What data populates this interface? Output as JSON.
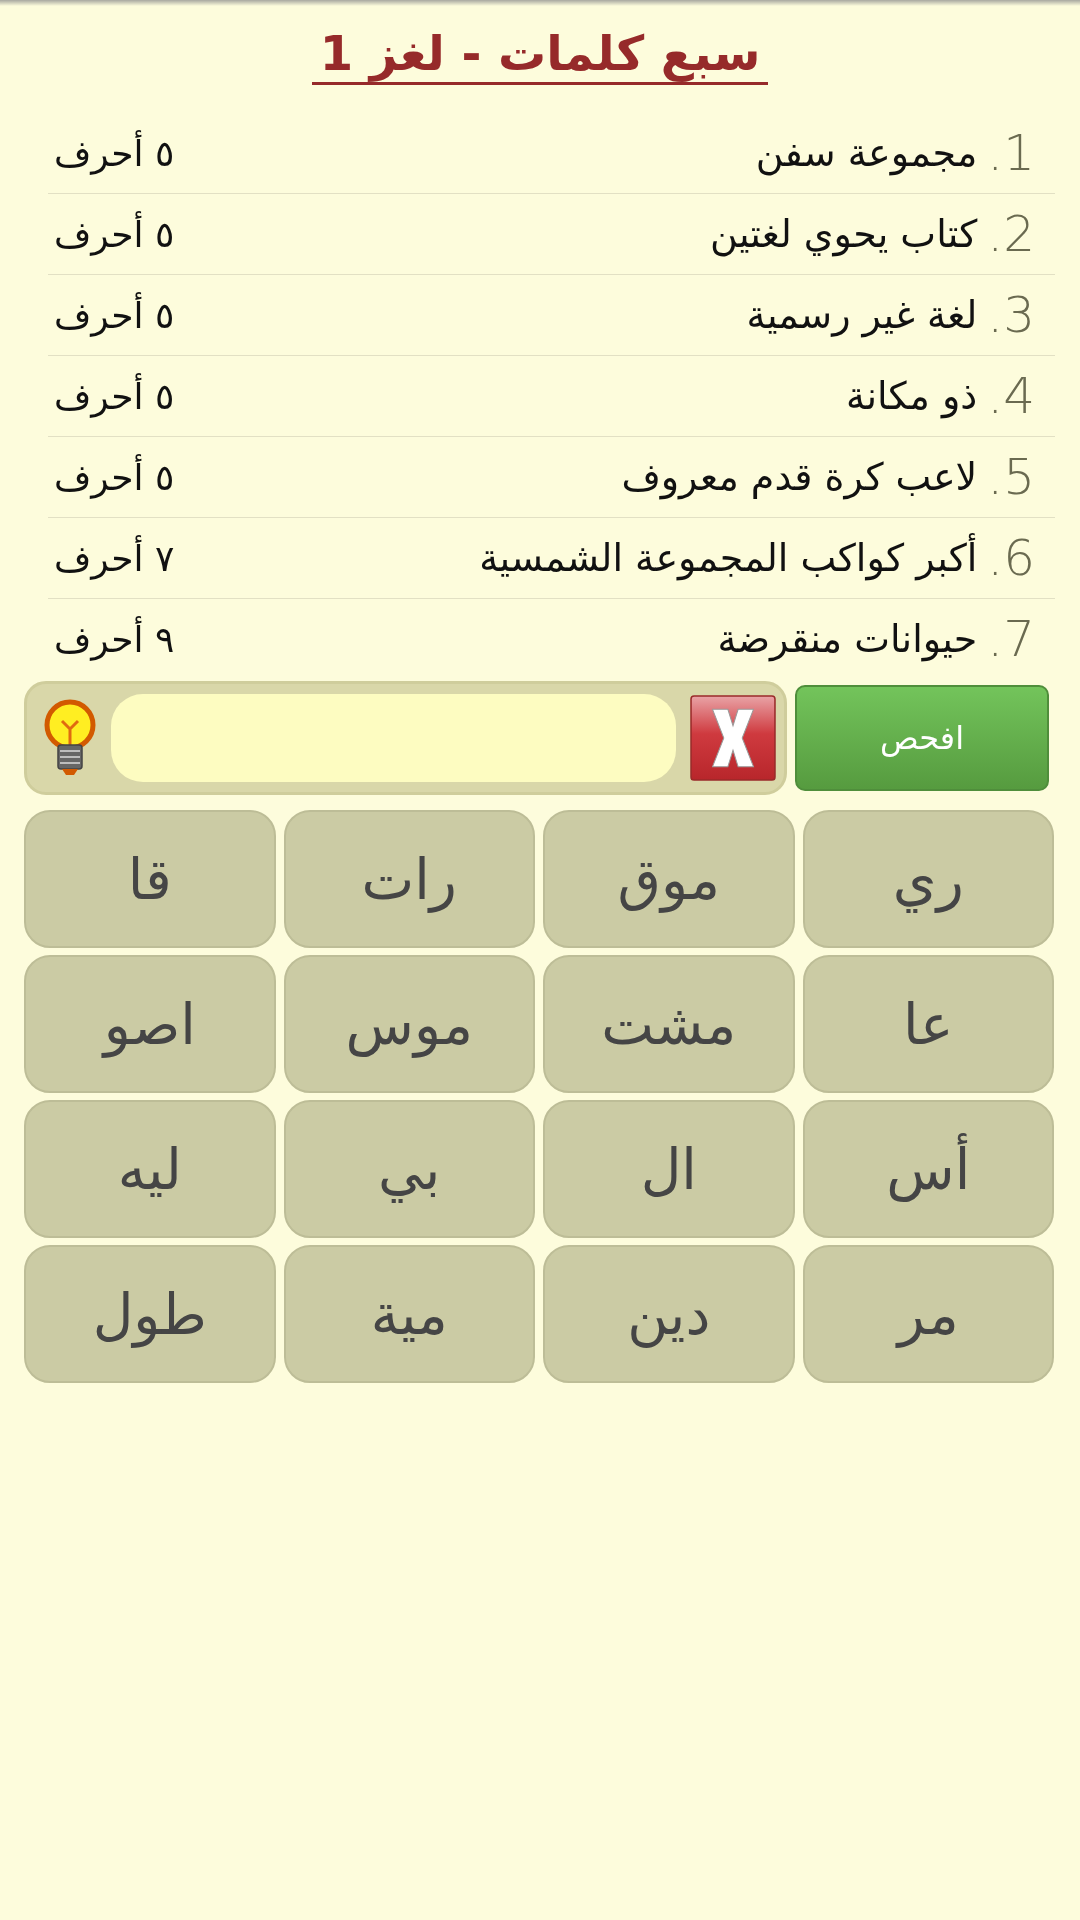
{
  "title": "سبع كلمات - لغز 1",
  "clues": [
    {
      "number": "1.",
      "text": "مجموعة سفن",
      "length": "٥ أحرف"
    },
    {
      "number": "2.",
      "text": "كتاب يحوي لغتين",
      "length": "٥ أحرف"
    },
    {
      "number": "3.",
      "text": "لغة غير رسمية",
      "length": "٥ أحرف"
    },
    {
      "number": "4.",
      "text": "ذو مكانة",
      "length": "٥ أحرف"
    },
    {
      "number": "5.",
      "text": "لاعب كرة قدم معروف",
      "length": "٥ أحرف"
    },
    {
      "number": "6.",
      "text": "أكبر كواكب المجموعة الشمسية",
      "length": "٧ أحرف"
    },
    {
      "number": "7.",
      "text": "حيوانات منقرضة",
      "length": "٩ أحرف"
    }
  ],
  "check_button": "افحص",
  "tiles": [
    "ري",
    "موق",
    "رات",
    "قا",
    "عا",
    "مشت",
    "موس",
    "اصو",
    "أس",
    "ال",
    "بي",
    "ليه",
    "مر",
    "دين",
    "مية",
    "طول"
  ]
}
